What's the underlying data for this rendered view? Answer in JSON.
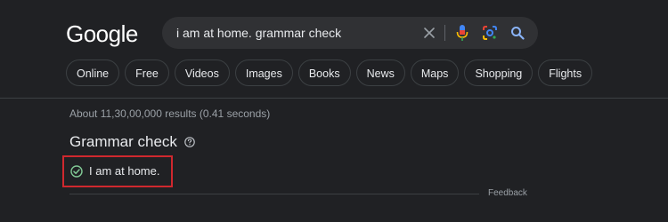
{
  "header": {
    "logo_text": "Google",
    "search": {
      "query": "i am at home. grammar check",
      "icons": [
        "clear-icon",
        "mic-icon",
        "lens-icon",
        "search-icon"
      ]
    }
  },
  "chips": [
    {
      "label": "Online"
    },
    {
      "label": "Free"
    },
    {
      "label": "Videos"
    },
    {
      "label": "Images"
    },
    {
      "label": "Books"
    },
    {
      "label": "News"
    },
    {
      "label": "Maps"
    },
    {
      "label": "Shopping"
    },
    {
      "label": "Flights"
    }
  ],
  "results": {
    "stats": "About 11,30,00,000 results (0.41 seconds)"
  },
  "grammar_check": {
    "title": "Grammar check",
    "corrected_text": "I am at home.",
    "status_icon": "check-circle-icon",
    "feedback_label": "Feedback"
  },
  "colors": {
    "background": "#202124",
    "search_bg": "#303134",
    "highlight_border": "#d0282e",
    "check_green": "#81c995",
    "muted_text": "#9aa0a6"
  }
}
